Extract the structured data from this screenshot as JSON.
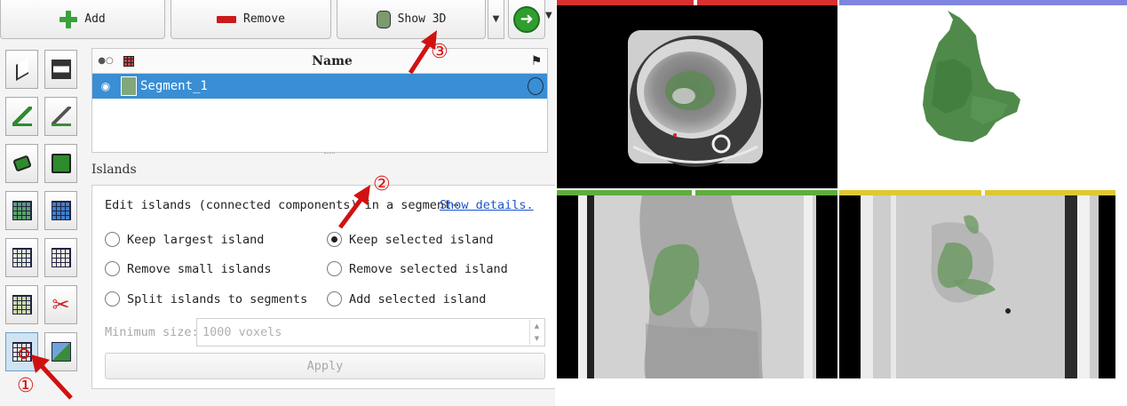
{
  "toolbar": {
    "add_label": "Add",
    "remove_label": "Remove",
    "show3d_label": "Show 3D",
    "dropdown_glyph": "▼"
  },
  "icons": {
    "add": "plus-icon",
    "remove": "minus-icon",
    "show3d": "box3d-icon",
    "next": "arrow-circle-icon"
  },
  "segments_table": {
    "columns": [
      "",
      "",
      "Name",
      ""
    ],
    "header_name": "Name",
    "rows": [
      {
        "name": "Segment_1",
        "color": "#82a87a",
        "visible": true,
        "selected": true
      }
    ]
  },
  "islands": {
    "section_title": "Islands",
    "description": "Edit islands (connected components) in a segment⋯",
    "show_details": "Show details.",
    "options": [
      {
        "label": "Keep largest island",
        "checked": false
      },
      {
        "label": "Keep selected island",
        "checked": true
      },
      {
        "label": "Remove small islands",
        "checked": false
      },
      {
        "label": "Remove selected island",
        "checked": false
      },
      {
        "label": "Split islands to segments",
        "checked": false
      },
      {
        "label": "Add selected island",
        "checked": false
      }
    ],
    "min_size_label": "Minimum size:",
    "min_size_value": "1000 voxels",
    "apply_label": "Apply"
  },
  "annotations": {
    "marker_1": "①",
    "marker_2": "②",
    "marker_3": "③"
  },
  "colors": {
    "selection": "#3a8ed3",
    "segment_green": "#82a87a",
    "annotation_red": "#d11111",
    "red_view_bar": "#d83030",
    "green_view_bar": "#5fae3d",
    "yellow_view_bar": "#e0c830",
    "3d_view_bar": "#7f84e0"
  }
}
